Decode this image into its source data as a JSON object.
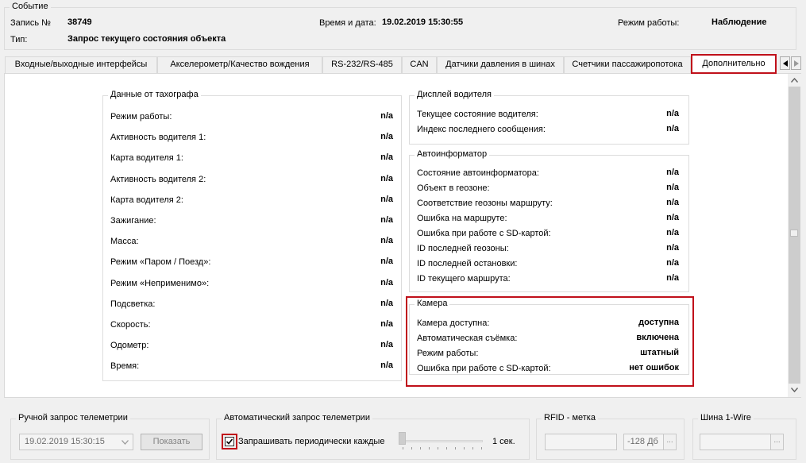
{
  "event": {
    "legend": "Событие",
    "record_label": "Запись №",
    "record_value": "38749",
    "datetime_label": "Время и дата:",
    "datetime_value": "19.02.2019 15:30:55",
    "mode_label": "Режим работы:",
    "mode_value": "Наблюдение",
    "type_label": "Тип:",
    "type_value": "Запрос текущего состояния объекта"
  },
  "tabs": [
    {
      "label": "Входные/выходные интерфейсы"
    },
    {
      "label": "Акселерометр/Качество вождения"
    },
    {
      "label": "RS-232/RS-485"
    },
    {
      "label": "CAN"
    },
    {
      "label": "Датчики давления в шинах"
    },
    {
      "label": "Счетчики пассажиропотока"
    },
    {
      "label": "Дополнительно",
      "active": true
    }
  ],
  "tab_nav": {
    "left_icon": "triangle-left",
    "right_icon": "triangle-right"
  },
  "tachograph": {
    "legend": "Данные от тахографа",
    "rows": [
      {
        "label": "Режим работы:",
        "value": "n/a"
      },
      {
        "label": "Активность водителя 1:",
        "value": "n/a"
      },
      {
        "label": "Карта водителя 1:",
        "value": "n/a"
      },
      {
        "label": "Активность водителя 2:",
        "value": "n/a"
      },
      {
        "label": "Карта водителя 2:",
        "value": "n/a"
      },
      {
        "label": "Зажигание:",
        "value": "n/a"
      },
      {
        "label": "Масса:",
        "value": "n/a"
      },
      {
        "label": "Режим «Паром / Поезд»:",
        "value": "n/a"
      },
      {
        "label": "Режим «Неприменимо»:",
        "value": "n/a"
      },
      {
        "label": "Подсветка:",
        "value": "n/a"
      },
      {
        "label": "Скорость:",
        "value": "n/a"
      },
      {
        "label": "Одометр:",
        "value": "n/a"
      },
      {
        "label": "Время:",
        "value": "n/a"
      }
    ]
  },
  "driver_display": {
    "legend": "Дисплей водителя",
    "rows": [
      {
        "label": "Текущее состояние водителя:",
        "value": "n/a"
      },
      {
        "label": "Индекс последнего сообщения:",
        "value": "n/a"
      }
    ]
  },
  "autoinformer": {
    "legend": "Автоинформатор",
    "rows": [
      {
        "label": "Состояние автоинформатора:",
        "value": "n/a"
      },
      {
        "label": "Объект в геозоне:",
        "value": "n/a"
      },
      {
        "label": "Соответствие геозоны маршруту:",
        "value": "n/a"
      },
      {
        "label": "Ошибка на маршруте:",
        "value": "n/a"
      },
      {
        "label": "Ошибка при работе с SD-картой:",
        "value": "n/a"
      },
      {
        "label": "ID последней геозоны:",
        "value": "n/a"
      },
      {
        "label": "ID последней остановки:",
        "value": "n/a"
      },
      {
        "label": "ID текущего маршрута:",
        "value": "n/a"
      }
    ]
  },
  "camera": {
    "legend": "Камера",
    "rows": [
      {
        "label": "Камера доступна:",
        "value": "доступна"
      },
      {
        "label": "Автоматическая съёмка:",
        "value": "включена"
      },
      {
        "label": "Режим работы:",
        "value": "штатный"
      },
      {
        "label": "Ошибка при работе с SD-картой:",
        "value": "нет ошибок"
      }
    ]
  },
  "manual_request": {
    "legend": "Ручной запрос телеметрии",
    "date_value": "19.02.2019 15:30:15",
    "show_button": "Показать"
  },
  "auto_request": {
    "legend": "Автоматический запрос телеметрии",
    "checkbox_label": "Запрашивать периодически каждые",
    "checked": true,
    "interval_value": "1 сек."
  },
  "rfid": {
    "legend": "RFID - метка",
    "value": "",
    "signal_value": "-128 Дб",
    "browse_label": "..."
  },
  "onewire": {
    "legend": "Шина 1-Wire",
    "value": "",
    "browse_label": "..."
  },
  "colors": {
    "highlight": "#c0101a",
    "background": "#f0f0f0",
    "panel": "#ffffff"
  }
}
